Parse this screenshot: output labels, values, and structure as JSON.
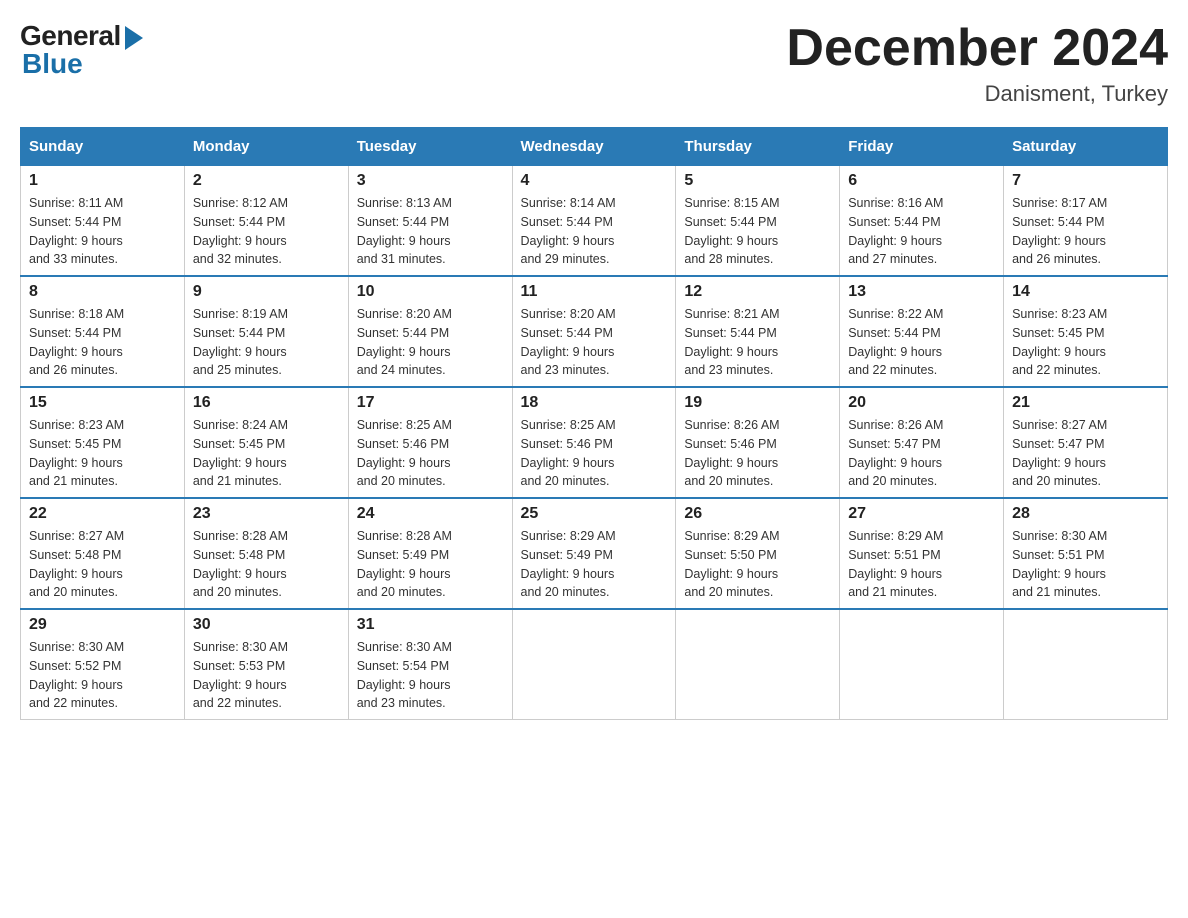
{
  "header": {
    "logo_general": "General",
    "logo_blue": "Blue",
    "month_title": "December 2024",
    "location": "Danisment, Turkey"
  },
  "days_of_week": [
    "Sunday",
    "Monday",
    "Tuesday",
    "Wednesday",
    "Thursday",
    "Friday",
    "Saturday"
  ],
  "weeks": [
    [
      {
        "day": "1",
        "sunrise": "8:11 AM",
        "sunset": "5:44 PM",
        "daylight": "9 hours and 33 minutes."
      },
      {
        "day": "2",
        "sunrise": "8:12 AM",
        "sunset": "5:44 PM",
        "daylight": "9 hours and 32 minutes."
      },
      {
        "day": "3",
        "sunrise": "8:13 AM",
        "sunset": "5:44 PM",
        "daylight": "9 hours and 31 minutes."
      },
      {
        "day": "4",
        "sunrise": "8:14 AM",
        "sunset": "5:44 PM",
        "daylight": "9 hours and 29 minutes."
      },
      {
        "day": "5",
        "sunrise": "8:15 AM",
        "sunset": "5:44 PM",
        "daylight": "9 hours and 28 minutes."
      },
      {
        "day": "6",
        "sunrise": "8:16 AM",
        "sunset": "5:44 PM",
        "daylight": "9 hours and 27 minutes."
      },
      {
        "day": "7",
        "sunrise": "8:17 AM",
        "sunset": "5:44 PM",
        "daylight": "9 hours and 26 minutes."
      }
    ],
    [
      {
        "day": "8",
        "sunrise": "8:18 AM",
        "sunset": "5:44 PM",
        "daylight": "9 hours and 26 minutes."
      },
      {
        "day": "9",
        "sunrise": "8:19 AM",
        "sunset": "5:44 PM",
        "daylight": "9 hours and 25 minutes."
      },
      {
        "day": "10",
        "sunrise": "8:20 AM",
        "sunset": "5:44 PM",
        "daylight": "9 hours and 24 minutes."
      },
      {
        "day": "11",
        "sunrise": "8:20 AM",
        "sunset": "5:44 PM",
        "daylight": "9 hours and 23 minutes."
      },
      {
        "day": "12",
        "sunrise": "8:21 AM",
        "sunset": "5:44 PM",
        "daylight": "9 hours and 23 minutes."
      },
      {
        "day": "13",
        "sunrise": "8:22 AM",
        "sunset": "5:44 PM",
        "daylight": "9 hours and 22 minutes."
      },
      {
        "day": "14",
        "sunrise": "8:23 AM",
        "sunset": "5:45 PM",
        "daylight": "9 hours and 22 minutes."
      }
    ],
    [
      {
        "day": "15",
        "sunrise": "8:23 AM",
        "sunset": "5:45 PM",
        "daylight": "9 hours and 21 minutes."
      },
      {
        "day": "16",
        "sunrise": "8:24 AM",
        "sunset": "5:45 PM",
        "daylight": "9 hours and 21 minutes."
      },
      {
        "day": "17",
        "sunrise": "8:25 AM",
        "sunset": "5:46 PM",
        "daylight": "9 hours and 20 minutes."
      },
      {
        "day": "18",
        "sunrise": "8:25 AM",
        "sunset": "5:46 PM",
        "daylight": "9 hours and 20 minutes."
      },
      {
        "day": "19",
        "sunrise": "8:26 AM",
        "sunset": "5:46 PM",
        "daylight": "9 hours and 20 minutes."
      },
      {
        "day": "20",
        "sunrise": "8:26 AM",
        "sunset": "5:47 PM",
        "daylight": "9 hours and 20 minutes."
      },
      {
        "day": "21",
        "sunrise": "8:27 AM",
        "sunset": "5:47 PM",
        "daylight": "9 hours and 20 minutes."
      }
    ],
    [
      {
        "day": "22",
        "sunrise": "8:27 AM",
        "sunset": "5:48 PM",
        "daylight": "9 hours and 20 minutes."
      },
      {
        "day": "23",
        "sunrise": "8:28 AM",
        "sunset": "5:48 PM",
        "daylight": "9 hours and 20 minutes."
      },
      {
        "day": "24",
        "sunrise": "8:28 AM",
        "sunset": "5:49 PM",
        "daylight": "9 hours and 20 minutes."
      },
      {
        "day": "25",
        "sunrise": "8:29 AM",
        "sunset": "5:49 PM",
        "daylight": "9 hours and 20 minutes."
      },
      {
        "day": "26",
        "sunrise": "8:29 AM",
        "sunset": "5:50 PM",
        "daylight": "9 hours and 20 minutes."
      },
      {
        "day": "27",
        "sunrise": "8:29 AM",
        "sunset": "5:51 PM",
        "daylight": "9 hours and 21 minutes."
      },
      {
        "day": "28",
        "sunrise": "8:30 AM",
        "sunset": "5:51 PM",
        "daylight": "9 hours and 21 minutes."
      }
    ],
    [
      {
        "day": "29",
        "sunrise": "8:30 AM",
        "sunset": "5:52 PM",
        "daylight": "9 hours and 22 minutes."
      },
      {
        "day": "30",
        "sunrise": "8:30 AM",
        "sunset": "5:53 PM",
        "daylight": "9 hours and 22 minutes."
      },
      {
        "day": "31",
        "sunrise": "8:30 AM",
        "sunset": "5:54 PM",
        "daylight": "9 hours and 23 minutes."
      },
      null,
      null,
      null,
      null
    ]
  ],
  "labels": {
    "sunrise": "Sunrise:",
    "sunset": "Sunset:",
    "daylight": "Daylight:"
  }
}
